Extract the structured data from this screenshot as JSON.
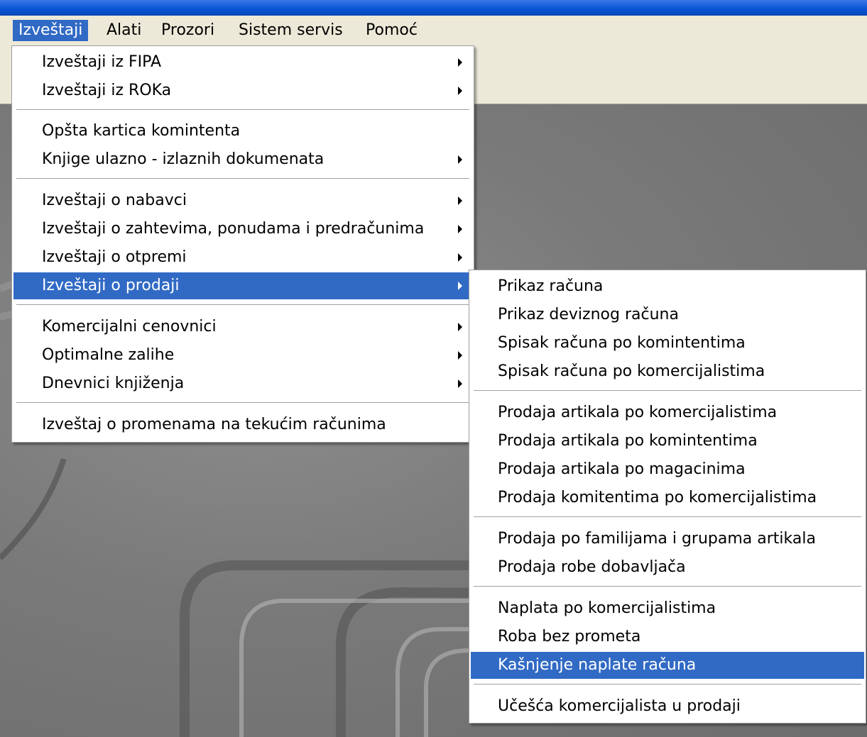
{
  "menubar": {
    "items": [
      "Izveštaji",
      "Alati",
      "Prozori",
      "Sistem servis",
      "Pomoć"
    ]
  },
  "reports_menu": {
    "items": [
      "Izveštaji iz FIPA",
      "Izveštaji iz ROKa",
      "Opšta kartica komintenta",
      "Knjige ulazno - izlaznih dokumenata",
      "Izveštaji o nabavci",
      "Izveštaji o zahtevima, ponudama i predračunima",
      "Izveštaji o otpremi",
      "Izveštaji o prodaji",
      "Komercijalni cenovnici",
      "Optimalne zalihe",
      "Dnevnici knjiženja",
      "Izveštaj o promenama na tekućim računima"
    ]
  },
  "sales_submenu": {
    "items": [
      "Prikaz računa",
      "Prikaz deviznog računa",
      "Spisak računa po komintentima",
      "Spisak računa po komercijalistima",
      "Prodaja artikala po komercijalistima",
      "Prodaja artikala po komintentima",
      "Prodaja artikala po magacinima",
      "Prodaja komitentima po komercijalistima",
      "Prodaja po familijama i grupama artikala",
      "Prodaja robe dobavljača",
      "Naplata po komercijalistima",
      "Roba bez prometa",
      "Kašnjenje naplate računa",
      "Učešća komercijalista u prodaji"
    ]
  },
  "colors": {
    "highlight": "#316ac5",
    "menu_background": "#ffffff",
    "workspace": "#7a7a7a"
  }
}
